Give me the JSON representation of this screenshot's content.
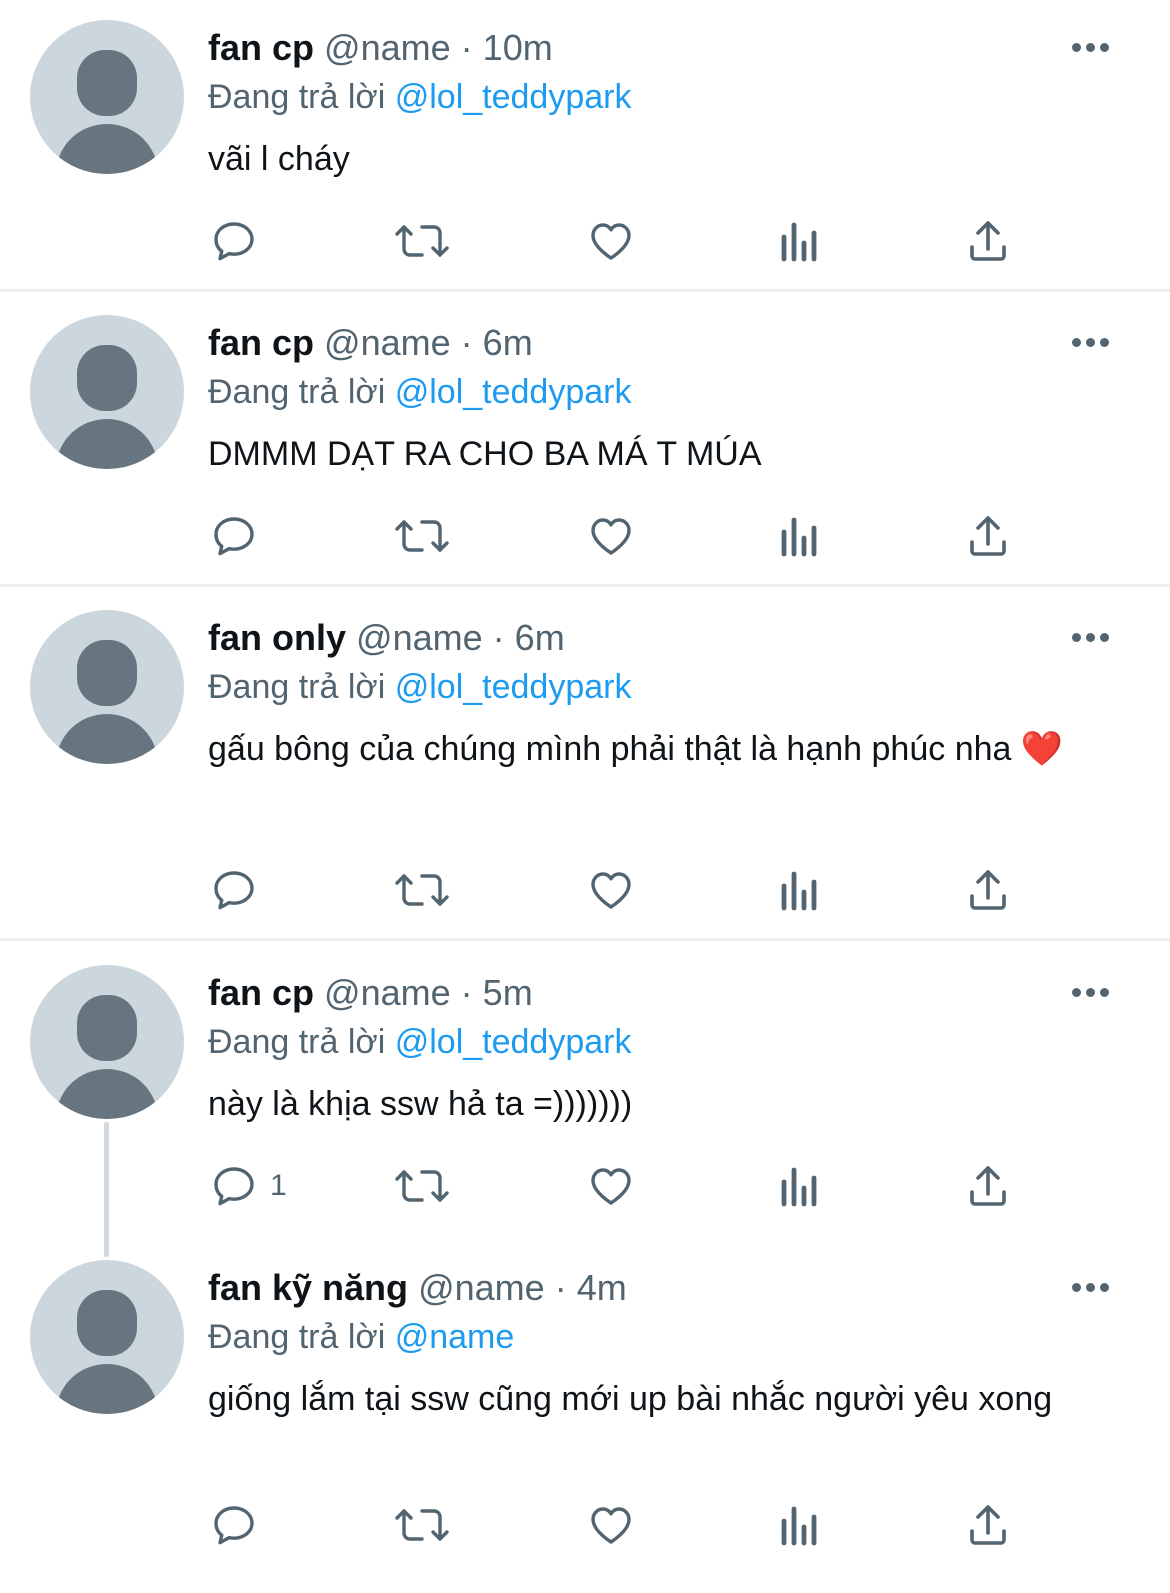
{
  "reply_prefix": "Đang trả lời",
  "icons": {
    "reply": "reply-icon",
    "retweet": "retweet-icon",
    "like": "heart-icon",
    "views": "bar-chart-icon",
    "share": "share-icon",
    "more": "more-icon"
  },
  "colors": {
    "link": "#1d9bf0",
    "meta": "#536471",
    "text": "#0f1419",
    "avatar_bg": "#ccd6dd",
    "avatar_fg": "#66757f"
  },
  "tweets": [
    {
      "name": "fan cp",
      "handle": "@name",
      "sep": "·",
      "time": "10m",
      "reply_to": "@lol_teddypark",
      "text": "vãi l cháy",
      "reply_count": ""
    },
    {
      "name": "fan cp",
      "handle": "@name",
      "sep": "·",
      "time": "6m",
      "reply_to": "@lol_teddypark",
      "text": "DMMM DẠT RA CHO BA MÁ T MÚA",
      "reply_count": ""
    },
    {
      "name": "fan only",
      "handle": "@name",
      "sep": "·",
      "time": "6m",
      "reply_to": "@lol_teddypark",
      "text": "gấu bông của chúng mình phải thật là hạnh phúc nha",
      "emoji": "❤️",
      "reply_count": ""
    },
    {
      "name": "fan cp",
      "handle": "@name",
      "sep": "·",
      "time": "5m",
      "reply_to": "@lol_teddypark",
      "text": "này là khịa ssw hả ta =)))))))",
      "reply_count": "1"
    },
    {
      "name": "fan kỹ năng",
      "handle": "@name",
      "sep": "·",
      "time": "4m",
      "reply_to": "@name",
      "text": "giống lắm tại ssw cũng mới up bài nhắc người yêu xong",
      "reply_count": ""
    }
  ]
}
